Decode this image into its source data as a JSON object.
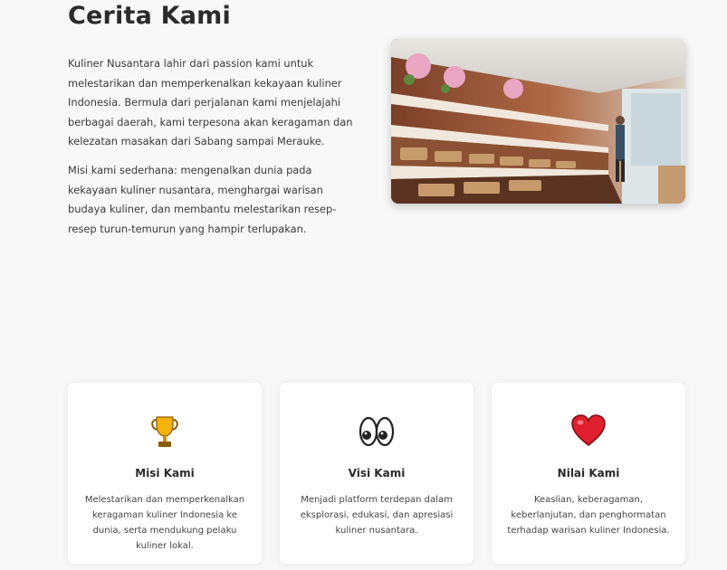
{
  "section": {
    "title": "Cerita Kami",
    "paragraphs": [
      "Kuliner Nusantara lahir dari passion kami untuk melestarikan dan memperkenalkan kekayaan kuliner Indonesia. Bermula dari perjalanan kami menjelajahi berbagai daerah, kami terpesona akan keragaman dan kelezatan masakan dari Sabang sampai Merauke.",
      "Misi kami sederhana: mengenalkan dunia pada kekayaan kuliner nusantara, menghargai warisan budaya kuliner, dan membantu melestarikan resep-resep turun-temurun yang hampir terlupakan."
    ]
  },
  "cards": [
    {
      "icon": "trophy-icon",
      "title": "Misi Kami",
      "text": "Melestarikan dan memperkenalkan keragaman kuliner Indonesia ke dunia, serta mendukung pelaku kuliner lokal."
    },
    {
      "icon": "eyes-icon",
      "title": "Visi Kami",
      "text": "Menjadi platform terdepan dalam eksplorasi, edukasi, dan apresiasi kuliner nusantara."
    },
    {
      "icon": "heart-icon",
      "title": "Nilai Kami",
      "text": "Keaslian, keberagaman, keberlanjutan, dan penghormatan terhadap warisan kuliner Indonesia."
    }
  ],
  "colors": {
    "background": "#f8f8f8",
    "card": "#ffffff",
    "heart": "#e0202e",
    "trophy": "#f5b30c"
  }
}
